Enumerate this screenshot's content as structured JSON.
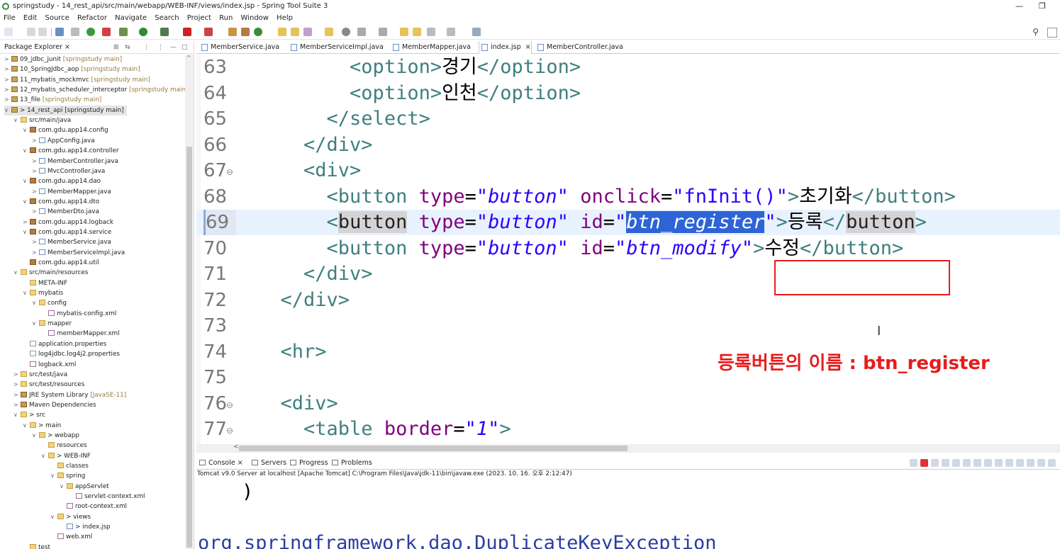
{
  "window": {
    "title": "springstudy - 14_rest_api/src/main/webapp/WEB-INF/views/index.jsp - Spring Tool Suite 3",
    "minimize": "—",
    "restore": "❐"
  },
  "menu": [
    "File",
    "Edit",
    "Source",
    "Refactor",
    "Navigate",
    "Search",
    "Project",
    "Run",
    "Window",
    "Help"
  ],
  "package_explorer": {
    "title": "Package Explorer",
    "close": "×",
    "tree": [
      {
        "label": "09_jdbc_junit",
        "deco": " [springstudy main]",
        "indent": 0,
        "twisty": ">",
        "icon": "proj"
      },
      {
        "label": "10_SpringJdbc_aop",
        "deco": " [springstudy main]",
        "indent": 0,
        "twisty": ">",
        "icon": "proj"
      },
      {
        "label": "11_mybatis_mockmvc",
        "deco": " [springstudy main]",
        "indent": 0,
        "twisty": ">",
        "icon": "proj"
      },
      {
        "label": "12_mybatis_scheduler_interceptor",
        "deco": " [springstudy main]",
        "indent": 0,
        "twisty": ">",
        "icon": "proj"
      },
      {
        "label": "13_file",
        "deco": " [springstudy main]",
        "indent": 0,
        "twisty": ">",
        "icon": "proj"
      },
      {
        "label": "> 14_rest_api [springstudy main]",
        "deco": "",
        "indent": 0,
        "twisty": "v",
        "icon": "proj",
        "selected": true
      },
      {
        "label": "src/main/java",
        "deco": "",
        "indent": 1,
        "twisty": "v",
        "icon": "folder"
      },
      {
        "label": "com.gdu.app14.config",
        "deco": "",
        "indent": 2,
        "twisty": "v",
        "icon": "pkg"
      },
      {
        "label": "AppConfig.java",
        "deco": "",
        "indent": 3,
        "twisty": ">",
        "icon": "java"
      },
      {
        "label": "com.gdu.app14.controller",
        "deco": "",
        "indent": 2,
        "twisty": "v",
        "icon": "pkg"
      },
      {
        "label": "MemberController.java",
        "deco": "",
        "indent": 3,
        "twisty": ">",
        "icon": "java"
      },
      {
        "label": "MvcController.java",
        "deco": "",
        "indent": 3,
        "twisty": ">",
        "icon": "java"
      },
      {
        "label": "com.gdu.app14.dao",
        "deco": "",
        "indent": 2,
        "twisty": "v",
        "icon": "pkg"
      },
      {
        "label": "MemberMapper.java",
        "deco": "",
        "indent": 3,
        "twisty": ">",
        "icon": "java"
      },
      {
        "label": "com.gdu.app14.dto",
        "deco": "",
        "indent": 2,
        "twisty": "v",
        "icon": "pkg"
      },
      {
        "label": "MemberDto.java",
        "deco": "",
        "indent": 3,
        "twisty": ">",
        "icon": "java"
      },
      {
        "label": "com.gdu.app14.logback",
        "deco": "",
        "indent": 2,
        "twisty": ">",
        "icon": "pkg"
      },
      {
        "label": "com.gdu.app14.service",
        "deco": "",
        "indent": 2,
        "twisty": "v",
        "icon": "pkg"
      },
      {
        "label": "MemberService.java",
        "deco": "",
        "indent": 3,
        "twisty": ">",
        "icon": "java"
      },
      {
        "label": "MemberServiceImpl.java",
        "deco": "",
        "indent": 3,
        "twisty": ">",
        "icon": "java"
      },
      {
        "label": "com.gdu.app14.util",
        "deco": "",
        "indent": 2,
        "twisty": "",
        "icon": "pkg"
      },
      {
        "label": "src/main/resources",
        "deco": "",
        "indent": 1,
        "twisty": "v",
        "icon": "folder"
      },
      {
        "label": "META-INF",
        "deco": "",
        "indent": 2,
        "twisty": "",
        "icon": "folder"
      },
      {
        "label": "mybatis",
        "deco": "",
        "indent": 2,
        "twisty": "v",
        "icon": "folder"
      },
      {
        "label": "config",
        "deco": "",
        "indent": 3,
        "twisty": "v",
        "icon": "folder"
      },
      {
        "label": "mybatis-config.xml",
        "deco": "",
        "indent": 4,
        "twisty": "",
        "icon": "xml"
      },
      {
        "label": "mapper",
        "deco": "",
        "indent": 3,
        "twisty": "v",
        "icon": "folder"
      },
      {
        "label": "memberMapper.xml",
        "deco": "",
        "indent": 4,
        "twisty": "",
        "icon": "xml"
      },
      {
        "label": "application.properties",
        "deco": "",
        "indent": 2,
        "twisty": "",
        "icon": "prop"
      },
      {
        "label": "log4jdbc.log4j2.properties",
        "deco": "",
        "indent": 2,
        "twisty": "",
        "icon": "prop"
      },
      {
        "label": "logback.xml",
        "deco": "",
        "indent": 2,
        "twisty": "",
        "icon": "xml"
      },
      {
        "label": "src/test/java",
        "deco": "",
        "indent": 1,
        "twisty": ">",
        "icon": "folder"
      },
      {
        "label": "src/test/resources",
        "deco": "",
        "indent": 1,
        "twisty": ">",
        "icon": "folder"
      },
      {
        "label": "JRE System Library",
        "deco": " [JavaSE-11]",
        "indent": 1,
        "twisty": ">",
        "icon": "lib"
      },
      {
        "label": "Maven Dependencies",
        "deco": "",
        "indent": 1,
        "twisty": ">",
        "icon": "lib"
      },
      {
        "label": "> src",
        "deco": "",
        "indent": 1,
        "twisty": "v",
        "icon": "folder"
      },
      {
        "label": "> main",
        "deco": "",
        "indent": 2,
        "twisty": "v",
        "icon": "folder"
      },
      {
        "label": "> webapp",
        "deco": "",
        "indent": 3,
        "twisty": "v",
        "icon": "folder"
      },
      {
        "label": "resources",
        "deco": "",
        "indent": 4,
        "twisty": "",
        "icon": "folder"
      },
      {
        "label": "> WEB-INF",
        "deco": "",
        "indent": 4,
        "twisty": "v",
        "icon": "folder"
      },
      {
        "label": "classes",
        "deco": "",
        "indent": 5,
        "twisty": "",
        "icon": "folder"
      },
      {
        "label": "spring",
        "deco": "",
        "indent": 5,
        "twisty": "v",
        "icon": "folder"
      },
      {
        "label": "appServlet",
        "deco": "",
        "indent": 6,
        "twisty": "v",
        "icon": "folder"
      },
      {
        "label": "servlet-context.xml",
        "deco": "",
        "indent": 7,
        "twisty": "",
        "icon": "xml"
      },
      {
        "label": "root-context.xml",
        "deco": "",
        "indent": 6,
        "twisty": "",
        "icon": "xml"
      },
      {
        "label": "> views",
        "deco": "",
        "indent": 5,
        "twisty": "v",
        "icon": "folder"
      },
      {
        "label": "> index.jsp",
        "deco": "",
        "indent": 6,
        "twisty": "",
        "icon": "java"
      },
      {
        "label": "web.xml",
        "deco": "",
        "indent": 5,
        "twisty": "",
        "icon": "xml"
      },
      {
        "label": "test",
        "deco": "",
        "indent": 2,
        "twisty": "",
        "icon": "folder"
      }
    ]
  },
  "editor_tabs": [
    {
      "label": "MemberService.java",
      "active": false
    },
    {
      "label": "MemberServiceImpl.java",
      "active": false
    },
    {
      "label": "MemberMapper.java",
      "active": false
    },
    {
      "label": "index.jsp",
      "active": true,
      "close": "×"
    },
    {
      "label": "MemberController.java",
      "active": false
    }
  ],
  "code_lines": [
    {
      "num": "63",
      "fold": false,
      "current": false,
      "tokens": [
        [
          "k",
          "        "
        ],
        [
          "t",
          "<option>"
        ],
        [
          "k",
          "경기"
        ],
        [
          "t",
          "</option>"
        ]
      ]
    },
    {
      "num": "64",
      "fold": false,
      "current": false,
      "tokens": [
        [
          "k",
          "        "
        ],
        [
          "t",
          "<option>"
        ],
        [
          "k",
          "인천"
        ],
        [
          "t",
          "</option>"
        ]
      ]
    },
    {
      "num": "65",
      "fold": false,
      "current": false,
      "tokens": [
        [
          "k",
          "      "
        ],
        [
          "t",
          "</select>"
        ]
      ]
    },
    {
      "num": "66",
      "fold": false,
      "current": false,
      "tokens": [
        [
          "k",
          "    "
        ],
        [
          "t",
          "</div>"
        ]
      ]
    },
    {
      "num": "67",
      "fold": true,
      "current": false,
      "tokens": [
        [
          "k",
          "    "
        ],
        [
          "t",
          "<div>"
        ]
      ]
    },
    {
      "num": "68",
      "fold": false,
      "current": false,
      "tokens": [
        [
          "k",
          "      "
        ],
        [
          "t",
          "<button "
        ],
        [
          "a",
          "type"
        ],
        [
          "k",
          "="
        ],
        [
          "v",
          "\"button\""
        ],
        [
          "k",
          " "
        ],
        [
          "a",
          "onclick"
        ],
        [
          "k",
          "="
        ],
        [
          "vn",
          "\"fnInit()\""
        ],
        [
          "t",
          ">"
        ],
        [
          "k",
          "초기화"
        ],
        [
          "t",
          "</button>"
        ]
      ]
    },
    {
      "num": "69",
      "fold": false,
      "current": true,
      "tokens": [
        [
          "k",
          "      "
        ],
        [
          "t",
          "<"
        ],
        [
          "hl",
          "button"
        ],
        [
          "k",
          " "
        ],
        [
          "a",
          "type"
        ],
        [
          "k",
          "="
        ],
        [
          "v",
          "\"button\""
        ],
        [
          "k",
          " "
        ],
        [
          "a",
          "id"
        ],
        [
          "k",
          "="
        ],
        [
          "v",
          "\""
        ],
        [
          "sel",
          "btn_register"
        ],
        [
          "v",
          "\""
        ],
        [
          "t",
          ">"
        ],
        [
          "k",
          "등록"
        ],
        [
          "t",
          "</"
        ],
        [
          "hl",
          "button"
        ],
        [
          "t",
          ">"
        ]
      ]
    },
    {
      "num": "70",
      "fold": false,
      "current": false,
      "tokens": [
        [
          "k",
          "      "
        ],
        [
          "t",
          "<button "
        ],
        [
          "a",
          "type"
        ],
        [
          "k",
          "="
        ],
        [
          "v",
          "\"button\""
        ],
        [
          "k",
          " "
        ],
        [
          "a",
          "id"
        ],
        [
          "k",
          "="
        ],
        [
          "v",
          "\"btn_modify\""
        ],
        [
          "t",
          ">"
        ],
        [
          "k",
          "수정"
        ],
        [
          "t",
          "</button>"
        ]
      ]
    },
    {
      "num": "71",
      "fold": false,
      "current": false,
      "tokens": [
        [
          "k",
          "    "
        ],
        [
          "t",
          "</div>"
        ]
      ]
    },
    {
      "num": "72",
      "fold": false,
      "current": false,
      "tokens": [
        [
          "k",
          "  "
        ],
        [
          "t",
          "</div>"
        ]
      ]
    },
    {
      "num": "73",
      "fold": false,
      "current": false,
      "tokens": []
    },
    {
      "num": "74",
      "fold": false,
      "current": false,
      "tokens": [
        [
          "k",
          "  "
        ],
        [
          "t",
          "<hr>"
        ]
      ]
    },
    {
      "num": "75",
      "fold": false,
      "current": false,
      "tokens": []
    },
    {
      "num": "76",
      "fold": true,
      "current": false,
      "tokens": [
        [
          "k",
          "  "
        ],
        [
          "t",
          "<div>"
        ]
      ]
    },
    {
      "num": "77",
      "fold": true,
      "current": false,
      "tokens": [
        [
          "k",
          "    "
        ],
        [
          "t",
          "<table "
        ],
        [
          "a",
          "border"
        ],
        [
          "k",
          "="
        ],
        [
          "v",
          "\"1\""
        ],
        [
          "t",
          ">"
        ]
      ]
    }
  ],
  "annotation": "등록버튼의 이름 : btn_register",
  "console": {
    "tabs": [
      "Console",
      "Servers",
      "Progress",
      "Problems"
    ],
    "console_close": "×",
    "info": "Tomcat v9.0 Server at localhost [Apache Tomcat] C:\\Program Files\\Java\\jdk-11\\bin\\javaw.exe  (2023. 10. 16. 오후 2:12:47)",
    "lines": [
      ")",
      "org.springframework.dao.DuplicateKeyException"
    ]
  }
}
